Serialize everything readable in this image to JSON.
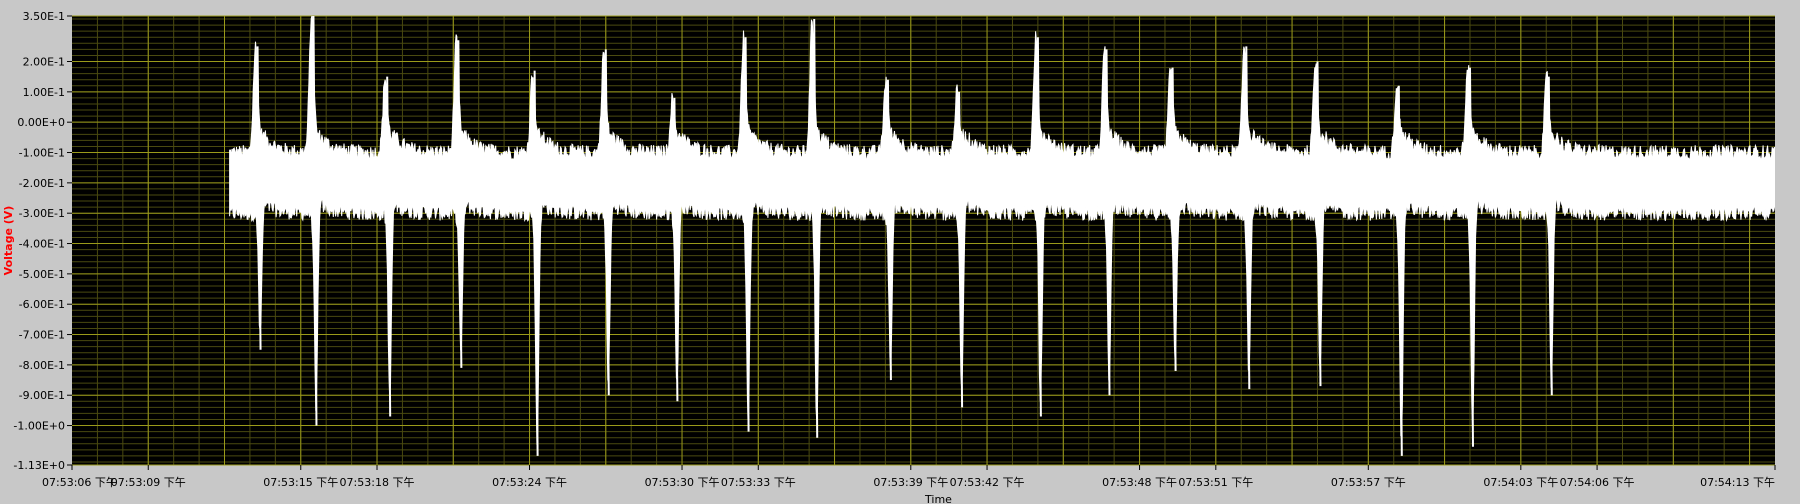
{
  "chart_data": {
    "type": "line",
    "xlabel": "Time",
    "ylabel": "Voltage (V)",
    "ylim": [
      -1.13,
      0.35
    ],
    "yticks": [
      "3.50E-1",
      "2.00E-1",
      "1.00E-1",
      "0.00E+0",
      "-1.00E-1",
      "-2.00E-1",
      "-3.00E-1",
      "-4.00E-1",
      "-5.00E-1",
      "-6.00E-1",
      "-7.00E-1",
      "-8.00E-1",
      "-9.00E-1",
      "-1.00E+0",
      "-1.13E+0"
    ],
    "ytick_values": [
      0.35,
      0.2,
      0.1,
      0.0,
      -0.1,
      -0.2,
      -0.3,
      -0.4,
      -0.5,
      -0.6,
      -0.7,
      -0.8,
      -0.9,
      -1.0,
      -1.13
    ],
    "xlim": [
      0,
      67
    ],
    "xtick_labels": [
      "07:53:06 下午",
      "07:53:09 下午",
      "07:53:15 下午",
      "07:53:18 下午",
      "07:53:24 下午",
      "07:53:30 下午",
      "07:53:33 下午",
      "07:53:39 下午",
      "07:53:42 下午",
      "07:53:48 下午",
      "07:53:51 下午",
      "07:53:57 下午",
      "07:54:03 下午",
      "07:54:06 下午",
      "07:54:13 下午"
    ],
    "xtick_seconds": [
      0,
      3,
      9,
      12,
      18,
      24,
      27,
      33,
      36,
      42,
      45,
      51,
      57,
      60,
      67
    ],
    "signal_start": 6.2,
    "signal_end": 67,
    "beats": [
      {
        "t": 7.3,
        "min": -0.75,
        "max": 0.25
      },
      {
        "t": 9.5,
        "min": -1.0,
        "max": 0.35
      },
      {
        "t": 12.4,
        "min": -0.97,
        "max": 0.15
      },
      {
        "t": 15.2,
        "min": -0.81,
        "max": 0.27
      },
      {
        "t": 18.2,
        "min": -1.1,
        "max": 0.17
      },
      {
        "t": 21.0,
        "min": -0.9,
        "max": 0.24
      },
      {
        "t": 23.7,
        "min": -0.92,
        "max": 0.08
      },
      {
        "t": 26.5,
        "min": -1.02,
        "max": 0.28
      },
      {
        "t": 29.2,
        "min": -1.04,
        "max": 0.34
      },
      {
        "t": 32.1,
        "min": -0.85,
        "max": 0.14
      },
      {
        "t": 34.9,
        "min": -0.94,
        "max": 0.1
      },
      {
        "t": 38.0,
        "min": -0.97,
        "max": 0.28
      },
      {
        "t": 40.7,
        "min": -0.9,
        "max": 0.24
      },
      {
        "t": 43.3,
        "min": -0.82,
        "max": 0.18
      },
      {
        "t": 46.2,
        "min": -0.88,
        "max": 0.25
      },
      {
        "t": 49.0,
        "min": -0.87,
        "max": 0.2
      },
      {
        "t": 52.2,
        "min": -1.1,
        "max": 0.12
      },
      {
        "t": 55.0,
        "min": -1.07,
        "max": 0.18
      },
      {
        "t": 58.1,
        "min": -0.9,
        "max": 0.15
      }
    ],
    "baseline": {
      "upper": -0.1,
      "lower": -0.3
    },
    "grid": true,
    "legend": "none",
    "colors": {
      "plot_background": "#000000",
      "grid": "#9a9a1a",
      "minor_grid": "#4a4a10",
      "signal": "#ffffff",
      "frame": "#c8c8c8",
      "ylabel": "#ff0000",
      "tick_text": "#000000"
    }
  }
}
